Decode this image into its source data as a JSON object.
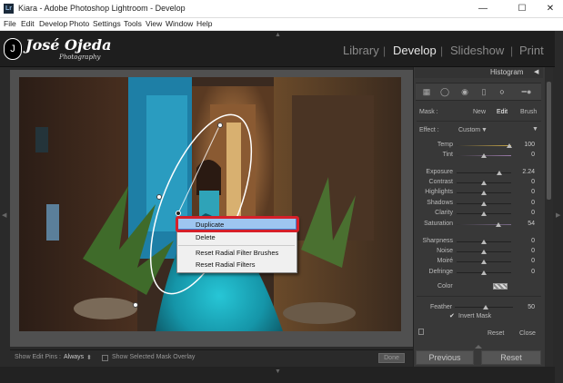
{
  "window": {
    "title": "Kiara - Adobe Photoshop Lightroom - Develop",
    "app_icon": "Lr",
    "minimize_icon": "minimize-icon",
    "maximize_icon": "maximize-icon",
    "close_icon": "close-icon"
  },
  "menu": [
    "File",
    "Edit",
    "Develop",
    "Photo",
    "Settings",
    "Tools",
    "View",
    "Window",
    "Help"
  ],
  "branding": {
    "logo_mark": "J",
    "name": "José Ojeda",
    "sub": "Photography"
  },
  "modules": {
    "library": "Library",
    "develop": "Develop",
    "slideshow": "Slideshow",
    "print": "Print",
    "separator": "|"
  },
  "panel": {
    "header": "Histogram",
    "header_arrow": "◀",
    "mask_label": "Mask :",
    "mask_new": "New",
    "mask_edit": "Edit",
    "mask_brush": "Brush",
    "effect_label": "Effect :",
    "effect_value": "Custom",
    "effect_arrow": "▼",
    "color_label": "Color",
    "feather_label": "Feather",
    "feather_value": "50",
    "invert_mask_label": "Invert Mask",
    "reset_label": "Reset",
    "close_label": "Close"
  },
  "sliders": {
    "temp": {
      "label": "Temp",
      "value": "100"
    },
    "tint": {
      "label": "Tint",
      "value": "0"
    },
    "exposure": {
      "label": "Exposure",
      "value": "2.24"
    },
    "contrast": {
      "label": "Contrast",
      "value": "0"
    },
    "highlights": {
      "label": "Highlights",
      "value": "0"
    },
    "shadows": {
      "label": "Shadows",
      "value": "0"
    },
    "clarity": {
      "label": "Clarity",
      "value": "0"
    },
    "saturation": {
      "label": "Saturation",
      "value": "54"
    },
    "sharpness": {
      "label": "Sharpness",
      "value": "0"
    },
    "noise": {
      "label": "Noise",
      "value": "0"
    },
    "moire": {
      "label": "Moiré",
      "value": "0"
    },
    "defringe": {
      "label": "Defringe",
      "value": "0"
    }
  },
  "buttons": {
    "previous": "Previous",
    "reset": "Reset",
    "done": "Done"
  },
  "toolbar": {
    "show_edit_pins_label": "Show Edit Pins :",
    "show_edit_pins_value": "Always",
    "show_edit_pins_arrow": "⬍",
    "show_overlay_label": "Show Selected Mask Overlay"
  },
  "context_menu": {
    "duplicate": "Duplicate",
    "delete": "Delete",
    "reset_brushes": "Reset Radial Filter Brushes",
    "reset_filters": "Reset Radial Filters"
  },
  "colors": {
    "accent_highlight": "#9ec6f0",
    "annotation_red": "#d6202a",
    "panel_bg": "#383838"
  }
}
